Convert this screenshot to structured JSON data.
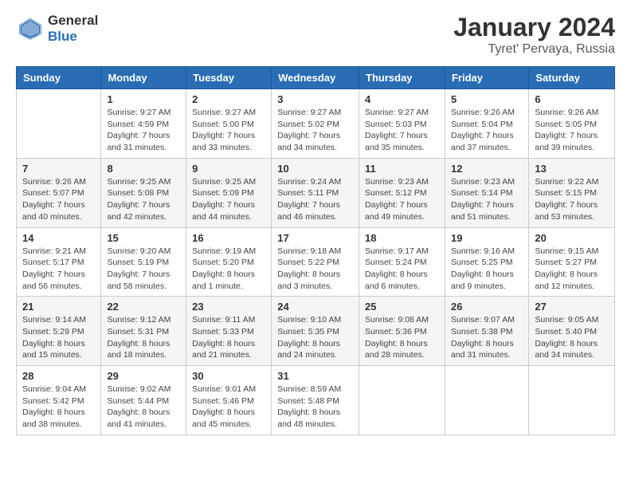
{
  "header": {
    "logo_general": "General",
    "logo_blue": "Blue",
    "title": "January 2024",
    "location": "Tyret' Pervaya, Russia"
  },
  "weekdays": [
    "Sunday",
    "Monday",
    "Tuesday",
    "Wednesday",
    "Thursday",
    "Friday",
    "Saturday"
  ],
  "weeks": [
    [
      {
        "day": "",
        "sunrise": "",
        "sunset": "",
        "daylight": ""
      },
      {
        "day": "1",
        "sunrise": "Sunrise: 9:27 AM",
        "sunset": "Sunset: 4:59 PM",
        "daylight": "Daylight: 7 hours and 31 minutes."
      },
      {
        "day": "2",
        "sunrise": "Sunrise: 9:27 AM",
        "sunset": "Sunset: 5:00 PM",
        "daylight": "Daylight: 7 hours and 33 minutes."
      },
      {
        "day": "3",
        "sunrise": "Sunrise: 9:27 AM",
        "sunset": "Sunset: 5:02 PM",
        "daylight": "Daylight: 7 hours and 34 minutes."
      },
      {
        "day": "4",
        "sunrise": "Sunrise: 9:27 AM",
        "sunset": "Sunset: 5:03 PM",
        "daylight": "Daylight: 7 hours and 35 minutes."
      },
      {
        "day": "5",
        "sunrise": "Sunrise: 9:26 AM",
        "sunset": "Sunset: 5:04 PM",
        "daylight": "Daylight: 7 hours and 37 minutes."
      },
      {
        "day": "6",
        "sunrise": "Sunrise: 9:26 AM",
        "sunset": "Sunset: 5:05 PM",
        "daylight": "Daylight: 7 hours and 39 minutes."
      }
    ],
    [
      {
        "day": "7",
        "sunrise": "Sunrise: 9:26 AM",
        "sunset": "Sunset: 5:07 PM",
        "daylight": "Daylight: 7 hours and 40 minutes."
      },
      {
        "day": "8",
        "sunrise": "Sunrise: 9:25 AM",
        "sunset": "Sunset: 5:08 PM",
        "daylight": "Daylight: 7 hours and 42 minutes."
      },
      {
        "day": "9",
        "sunrise": "Sunrise: 9:25 AM",
        "sunset": "Sunset: 5:09 PM",
        "daylight": "Daylight: 7 hours and 44 minutes."
      },
      {
        "day": "10",
        "sunrise": "Sunrise: 9:24 AM",
        "sunset": "Sunset: 5:11 PM",
        "daylight": "Daylight: 7 hours and 46 minutes."
      },
      {
        "day": "11",
        "sunrise": "Sunrise: 9:23 AM",
        "sunset": "Sunset: 5:12 PM",
        "daylight": "Daylight: 7 hours and 49 minutes."
      },
      {
        "day": "12",
        "sunrise": "Sunrise: 9:23 AM",
        "sunset": "Sunset: 5:14 PM",
        "daylight": "Daylight: 7 hours and 51 minutes."
      },
      {
        "day": "13",
        "sunrise": "Sunrise: 9:22 AM",
        "sunset": "Sunset: 5:15 PM",
        "daylight": "Daylight: 7 hours and 53 minutes."
      }
    ],
    [
      {
        "day": "14",
        "sunrise": "Sunrise: 9:21 AM",
        "sunset": "Sunset: 5:17 PM",
        "daylight": "Daylight: 7 hours and 56 minutes."
      },
      {
        "day": "15",
        "sunrise": "Sunrise: 9:20 AM",
        "sunset": "Sunset: 5:19 PM",
        "daylight": "Daylight: 7 hours and 58 minutes."
      },
      {
        "day": "16",
        "sunrise": "Sunrise: 9:19 AM",
        "sunset": "Sunset: 5:20 PM",
        "daylight": "Daylight: 8 hours and 1 minute."
      },
      {
        "day": "17",
        "sunrise": "Sunrise: 9:18 AM",
        "sunset": "Sunset: 5:22 PM",
        "daylight": "Daylight: 8 hours and 3 minutes."
      },
      {
        "day": "18",
        "sunrise": "Sunrise: 9:17 AM",
        "sunset": "Sunset: 5:24 PM",
        "daylight": "Daylight: 8 hours and 6 minutes."
      },
      {
        "day": "19",
        "sunrise": "Sunrise: 9:16 AM",
        "sunset": "Sunset: 5:25 PM",
        "daylight": "Daylight: 8 hours and 9 minutes."
      },
      {
        "day": "20",
        "sunrise": "Sunrise: 9:15 AM",
        "sunset": "Sunset: 5:27 PM",
        "daylight": "Daylight: 8 hours and 12 minutes."
      }
    ],
    [
      {
        "day": "21",
        "sunrise": "Sunrise: 9:14 AM",
        "sunset": "Sunset: 5:29 PM",
        "daylight": "Daylight: 8 hours and 15 minutes."
      },
      {
        "day": "22",
        "sunrise": "Sunrise: 9:12 AM",
        "sunset": "Sunset: 5:31 PM",
        "daylight": "Daylight: 8 hours and 18 minutes."
      },
      {
        "day": "23",
        "sunrise": "Sunrise: 9:11 AM",
        "sunset": "Sunset: 5:33 PM",
        "daylight": "Daylight: 8 hours and 21 minutes."
      },
      {
        "day": "24",
        "sunrise": "Sunrise: 9:10 AM",
        "sunset": "Sunset: 5:35 PM",
        "daylight": "Daylight: 8 hours and 24 minutes."
      },
      {
        "day": "25",
        "sunrise": "Sunrise: 9:08 AM",
        "sunset": "Sunset: 5:36 PM",
        "daylight": "Daylight: 8 hours and 28 minutes."
      },
      {
        "day": "26",
        "sunrise": "Sunrise: 9:07 AM",
        "sunset": "Sunset: 5:38 PM",
        "daylight": "Daylight: 8 hours and 31 minutes."
      },
      {
        "day": "27",
        "sunrise": "Sunrise: 9:05 AM",
        "sunset": "Sunset: 5:40 PM",
        "daylight": "Daylight: 8 hours and 34 minutes."
      }
    ],
    [
      {
        "day": "28",
        "sunrise": "Sunrise: 9:04 AM",
        "sunset": "Sunset: 5:42 PM",
        "daylight": "Daylight: 8 hours and 38 minutes."
      },
      {
        "day": "29",
        "sunrise": "Sunrise: 9:02 AM",
        "sunset": "Sunset: 5:44 PM",
        "daylight": "Daylight: 8 hours and 41 minutes."
      },
      {
        "day": "30",
        "sunrise": "Sunrise: 9:01 AM",
        "sunset": "Sunset: 5:46 PM",
        "daylight": "Daylight: 8 hours and 45 minutes."
      },
      {
        "day": "31",
        "sunrise": "Sunrise: 8:59 AM",
        "sunset": "Sunset: 5:48 PM",
        "daylight": "Daylight: 8 hours and 48 minutes."
      },
      {
        "day": "",
        "sunrise": "",
        "sunset": "",
        "daylight": ""
      },
      {
        "day": "",
        "sunrise": "",
        "sunset": "",
        "daylight": ""
      },
      {
        "day": "",
        "sunrise": "",
        "sunset": "",
        "daylight": ""
      }
    ]
  ]
}
